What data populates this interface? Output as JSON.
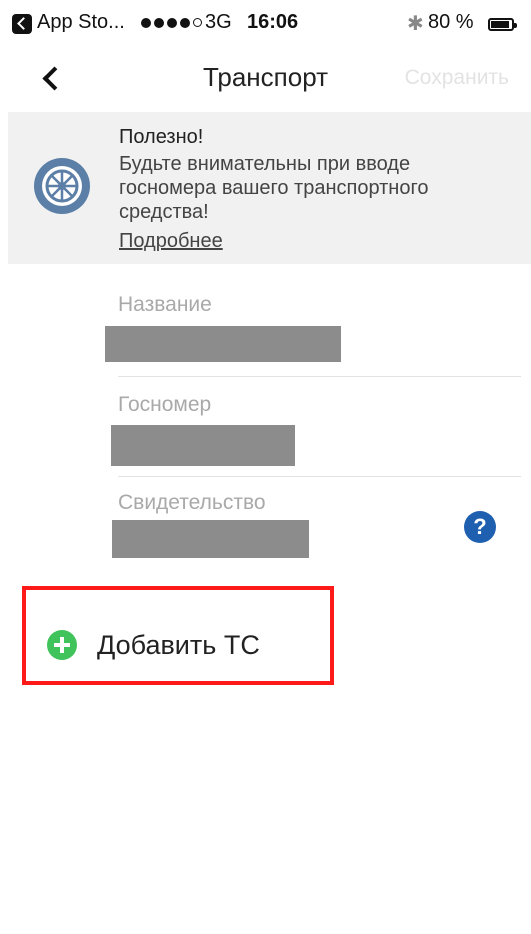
{
  "status_bar": {
    "back_app": "App Sto...",
    "network": "3G",
    "time": "16:06",
    "battery": "80 %"
  },
  "nav": {
    "title": "Транспорт",
    "save_label": "Сохранить"
  },
  "banner": {
    "title": "Полезно!",
    "text": "Будьте внимательны при вводе госномера вашего транспортного средства!",
    "link": "Подробнее",
    "icon": "wheel-icon"
  },
  "form": {
    "name_label": "Название",
    "plate_label": "Госномер",
    "certificate_label": "Свидетельство",
    "help_symbol": "?"
  },
  "actions": {
    "add_vehicle_label": "Добавить ТС"
  },
  "colors": {
    "accent_blue": "#1f5fb0",
    "add_green": "#3fc35a",
    "highlight_red": "#ff1a1a",
    "banner_bg": "#f1f1f1"
  }
}
